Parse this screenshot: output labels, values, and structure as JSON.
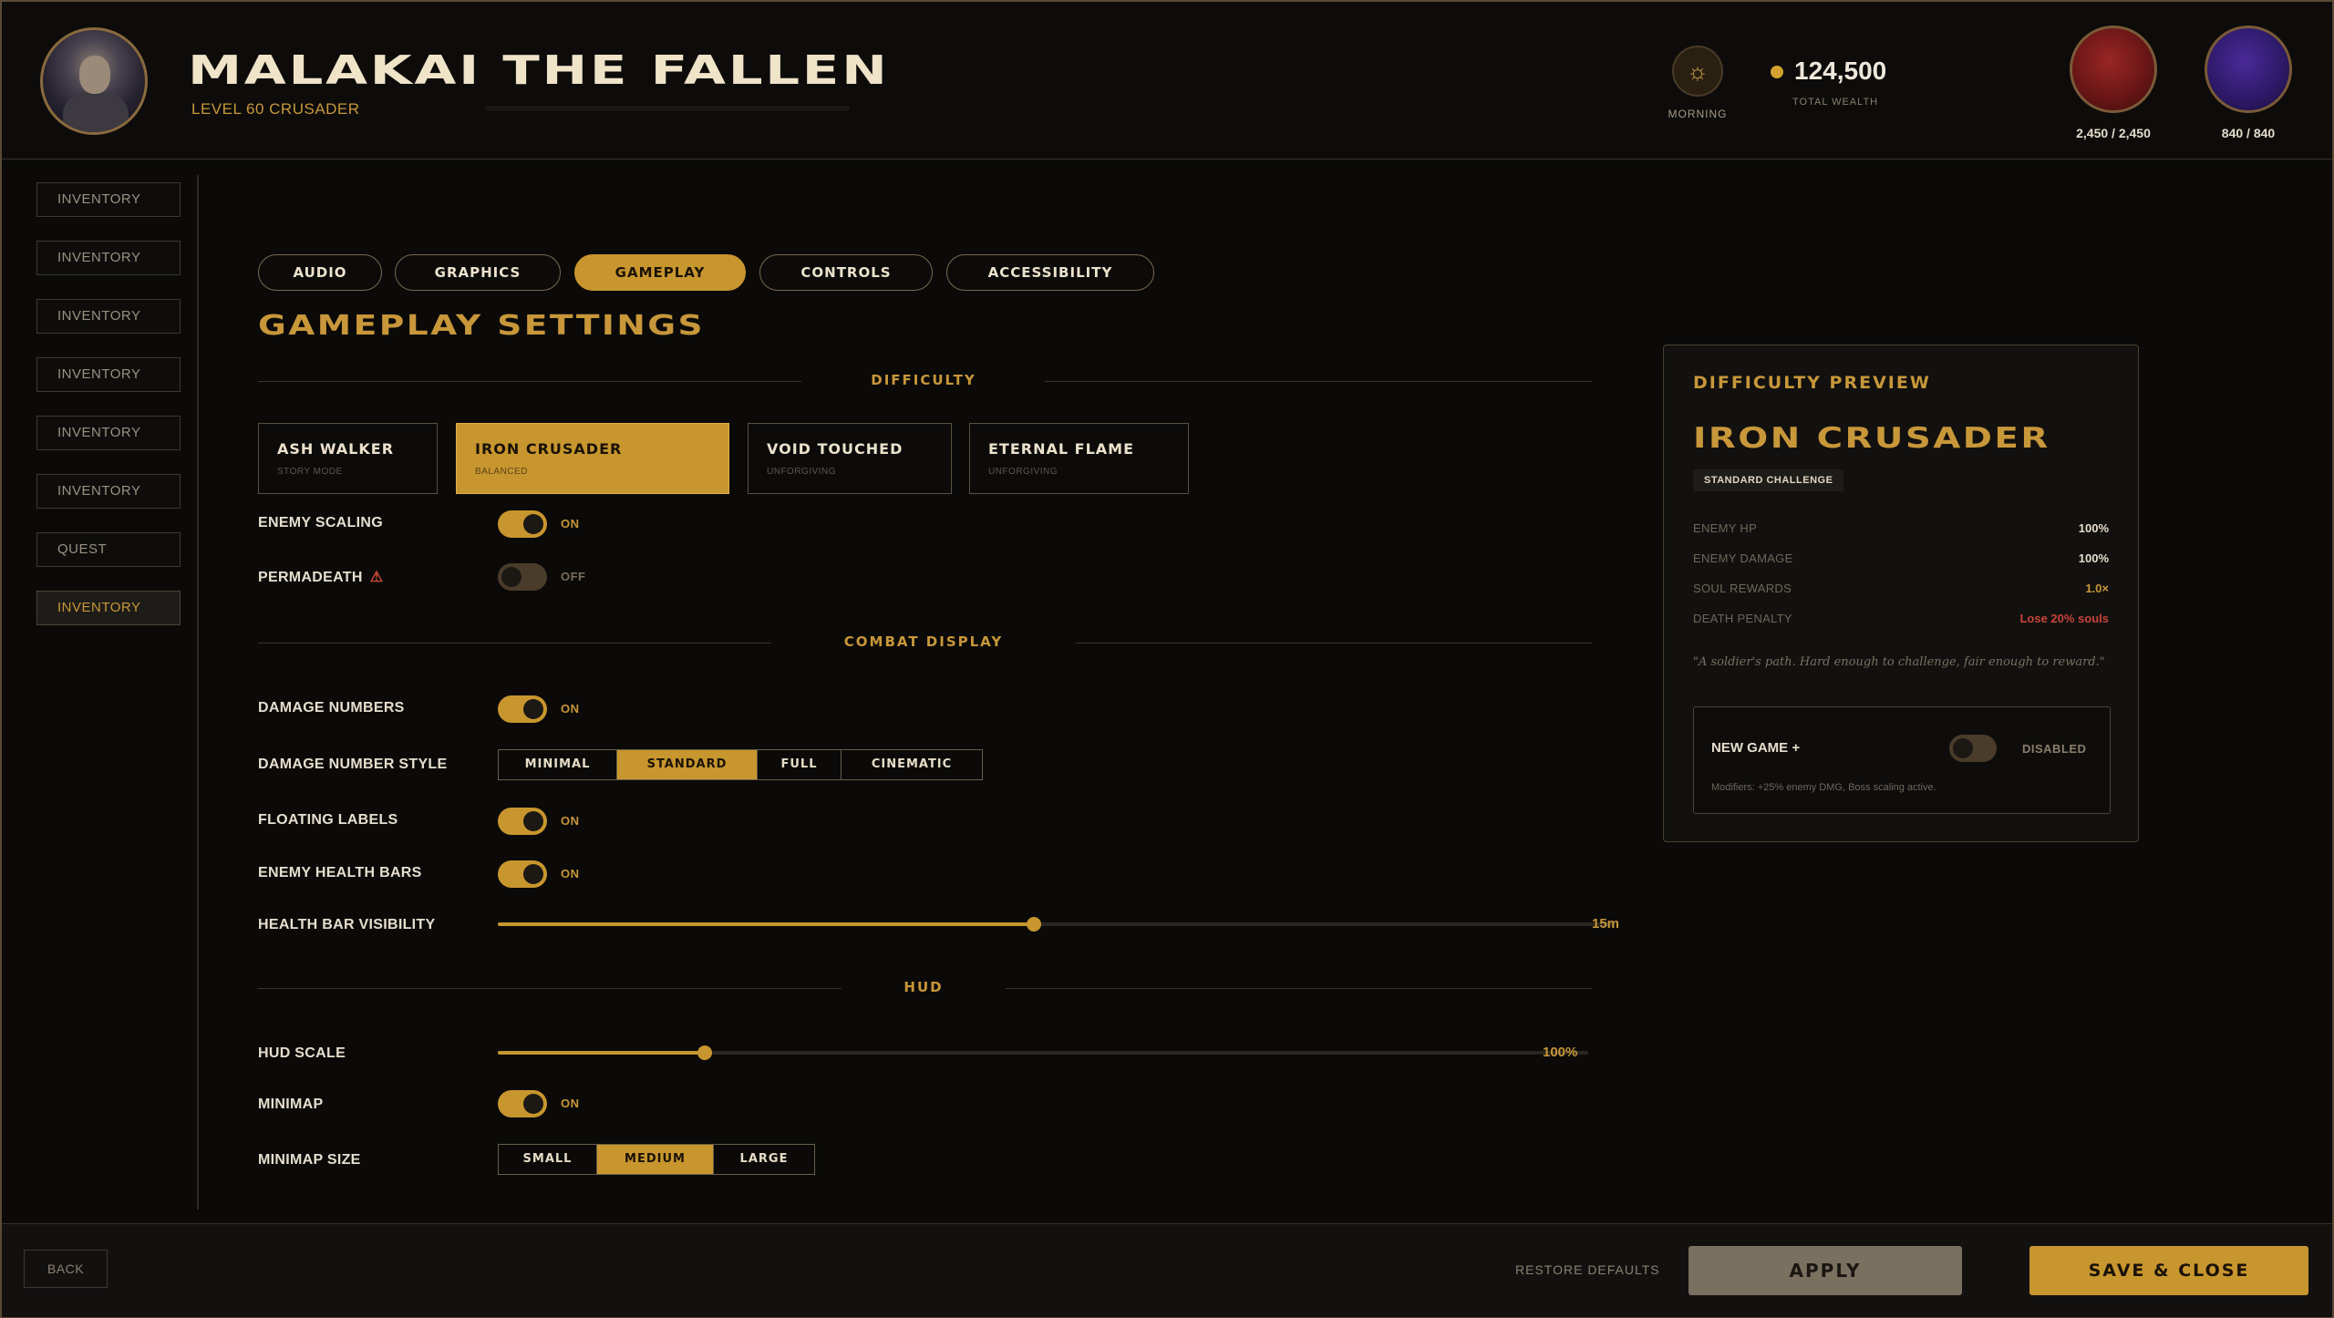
{
  "header": {
    "name": "MALAKAI THE FALLEN",
    "level": "LEVEL 60 CRUSADER",
    "time_of_day": "MORNING",
    "time_icon": "sun-icon",
    "wealth_value": "124,500",
    "wealth_label": "TOTAL WEALTH",
    "health": "2,450 / 2,450",
    "mana": "840 / 840",
    "colors": {
      "accent": "#c8962e",
      "health_orb": "#8a2020",
      "mana_orb": "#3a2080"
    }
  },
  "sidebar": {
    "items": [
      {
        "label": "INVENTORY"
      },
      {
        "label": "INVENTORY"
      },
      {
        "label": "INVENTORY"
      },
      {
        "label": "INVENTORY"
      },
      {
        "label": "INVENTORY"
      },
      {
        "label": "INVENTORY"
      },
      {
        "label": "QUEST"
      },
      {
        "label": "INVENTORY"
      }
    ],
    "active_index": 7
  },
  "tabs": [
    {
      "label": "AUDIO"
    },
    {
      "label": "GRAPHICS"
    },
    {
      "label": "GAMEPLAY"
    },
    {
      "label": "CONTROLS"
    },
    {
      "label": "ACCESSIBILITY"
    }
  ],
  "active_tab": "GAMEPLAY",
  "page_title": "GAMEPLAY SETTINGS",
  "difficulty": {
    "section_title": "DIFFICULTY",
    "options": [
      {
        "name": "ASH WALKER",
        "sub": "STORY MODE"
      },
      {
        "name": "IRON CRUSADER",
        "sub": "BALANCED"
      },
      {
        "name": "VOID TOUCHED",
        "sub": "UNFORGIVING"
      },
      {
        "name": "ETERNAL FLAME",
        "sub": "UNFORGIVING"
      }
    ],
    "selected": "IRON CRUSADER",
    "enemy_scaling": {
      "label": "ENEMY SCALING",
      "state": "ON"
    },
    "permadeath": {
      "label": "PERMADEATH",
      "state": "OFF",
      "icon": "warning-icon"
    }
  },
  "combat_display": {
    "section_title": "COMBAT DISPLAY",
    "damage_numbers": {
      "label": "DAMAGE NUMBERS",
      "state": "ON"
    },
    "damage_style": {
      "label": "DAMAGE NUMBER STYLE",
      "options": [
        "MINIMAL",
        "STANDARD",
        "FULL",
        "CINEMATIC"
      ],
      "selected": "STANDARD"
    },
    "floating_labels": {
      "label": "FLOATING LABELS",
      "state": "ON"
    },
    "enemy_health_bars": {
      "label": "ENEMY HEALTH BARS",
      "state": "ON"
    },
    "health_bar_visibility": {
      "label": "HEALTH BAR VISIBILITY",
      "value": "15m",
      "fraction": 0.48
    }
  },
  "hud": {
    "section_title": "HUD",
    "hud_scale": {
      "label": "HUD SCALE",
      "value": "100%",
      "fraction": 0.19
    },
    "minimap": {
      "label": "MINIMAP",
      "state": "ON"
    },
    "minimap_size": {
      "label": "MINIMAP SIZE",
      "options": [
        "SMALL",
        "MEDIUM",
        "LARGE"
      ],
      "selected": "MEDIUM"
    }
  },
  "preview": {
    "title": "DIFFICULTY PREVIEW",
    "name": "IRON CRUSADER",
    "badge": "STANDARD CHALLENGE",
    "stats": [
      {
        "label": "ENEMY HP",
        "value": "100%"
      },
      {
        "label": "ENEMY DAMAGE",
        "value": "100%"
      },
      {
        "label": "SOUL REWARDS",
        "value": "1.0×"
      },
      {
        "label": "DEATH PENALTY",
        "value": "Lose 20% souls"
      }
    ],
    "quote": "\"A soldier's path. Hard enough to challenge, fair enough to reward.\"",
    "new_game_plus": {
      "label": "NEW GAME +",
      "state": "DISABLED",
      "modifiers": "Modifiers: +25% enemy DMG, Boss scaling active."
    }
  },
  "footer": {
    "back": "BACK",
    "restore": "RESTORE DEFAULTS",
    "apply": "APPLY",
    "save": "SAVE & CLOSE"
  }
}
